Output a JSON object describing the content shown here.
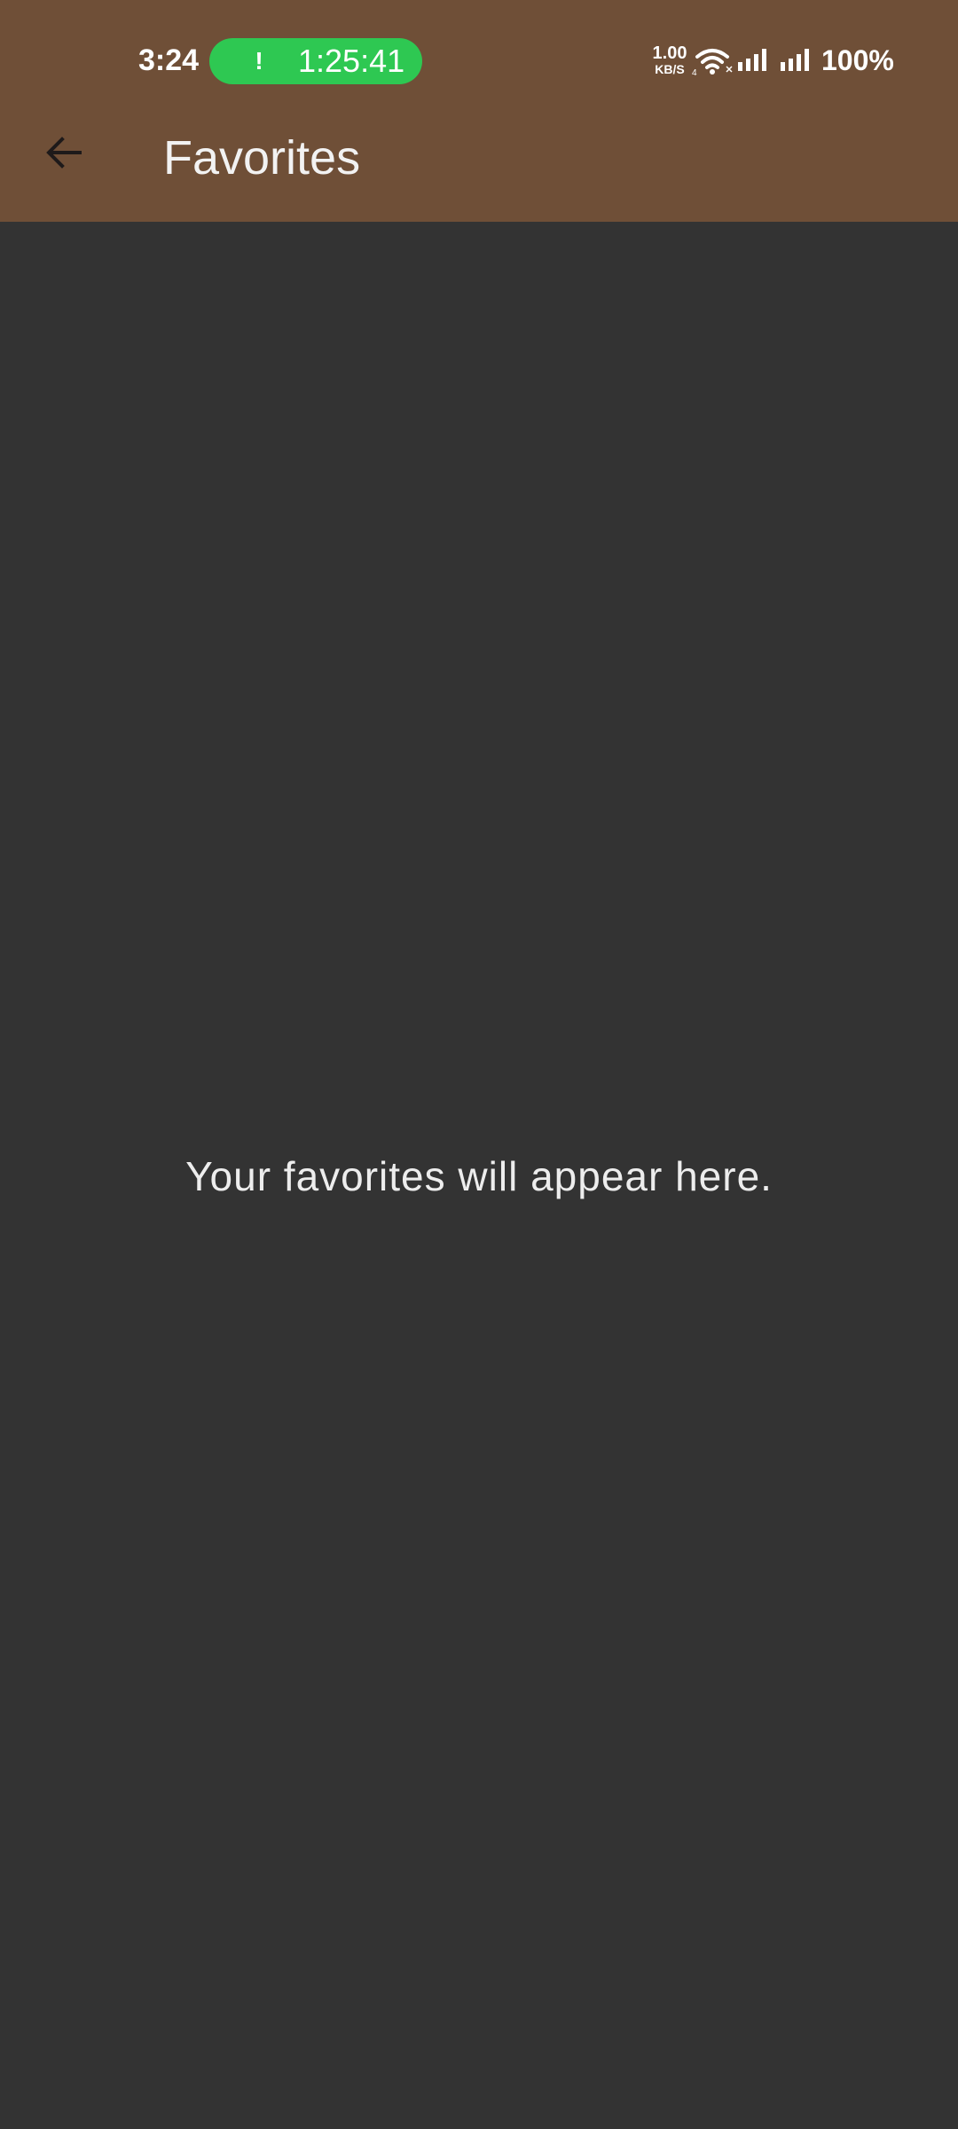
{
  "colors": {
    "appbar_bg": "#6F4F37",
    "content_bg": "#333333",
    "call_pill": "#2EC852",
    "text": "#F2F2F2"
  },
  "status_bar": {
    "time": "3:24",
    "call_icon": "exclamation-icon",
    "call_timer": "1:25:41",
    "net_speed_value": "1.00",
    "net_speed_unit": "KB/S",
    "battery": "100%"
  },
  "app_bar": {
    "back_icon": "arrow-left-icon",
    "title": "Favorites"
  },
  "main": {
    "empty_message": "Your favorites will appear here."
  }
}
